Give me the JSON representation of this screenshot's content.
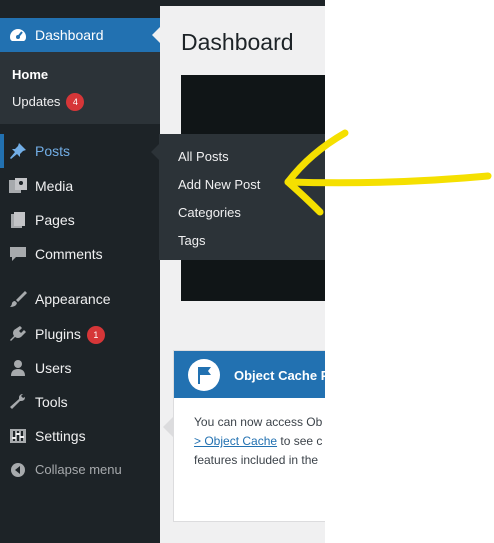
{
  "sidebar": {
    "dashboard": {
      "label": "Dashboard",
      "icon": "dashboard-gauge-icon"
    },
    "submenu": {
      "home": "Home",
      "updates": "Updates",
      "updates_badge": "4"
    },
    "items": [
      {
        "key": "posts",
        "label": "Posts",
        "icon": "pushpin-icon"
      },
      {
        "key": "media",
        "label": "Media",
        "icon": "media-icon"
      },
      {
        "key": "pages",
        "label": "Pages",
        "icon": "pages-icon"
      },
      {
        "key": "comments",
        "label": "Comments",
        "icon": "comment-icon"
      },
      {
        "key": "appearance",
        "label": "Appearance",
        "icon": "paintbrush-icon"
      },
      {
        "key": "plugins",
        "label": "Plugins",
        "icon": "plug-icon",
        "badge": "1"
      },
      {
        "key": "users",
        "label": "Users",
        "icon": "user-icon"
      },
      {
        "key": "tools",
        "label": "Tools",
        "icon": "wrench-icon"
      },
      {
        "key": "settings",
        "label": "Settings",
        "icon": "sliders-icon"
      }
    ],
    "collapse": "Collapse menu"
  },
  "flyout": {
    "items": [
      "All Posts",
      "Add New Post",
      "Categories",
      "Tags"
    ]
  },
  "main": {
    "title": "Dashboard",
    "card": {
      "title": "Object Cache P",
      "line1": "You can now access Ob",
      "link": "> Object Cache",
      "line2_rest": " to see c",
      "line3": "features included in the"
    }
  },
  "colors": {
    "sidebar_bg": "#1d2327",
    "submenu_bg": "#2c3338",
    "accent": "#2271b1",
    "badge": "#d63638",
    "annotation_arrow": "#f5e000"
  }
}
